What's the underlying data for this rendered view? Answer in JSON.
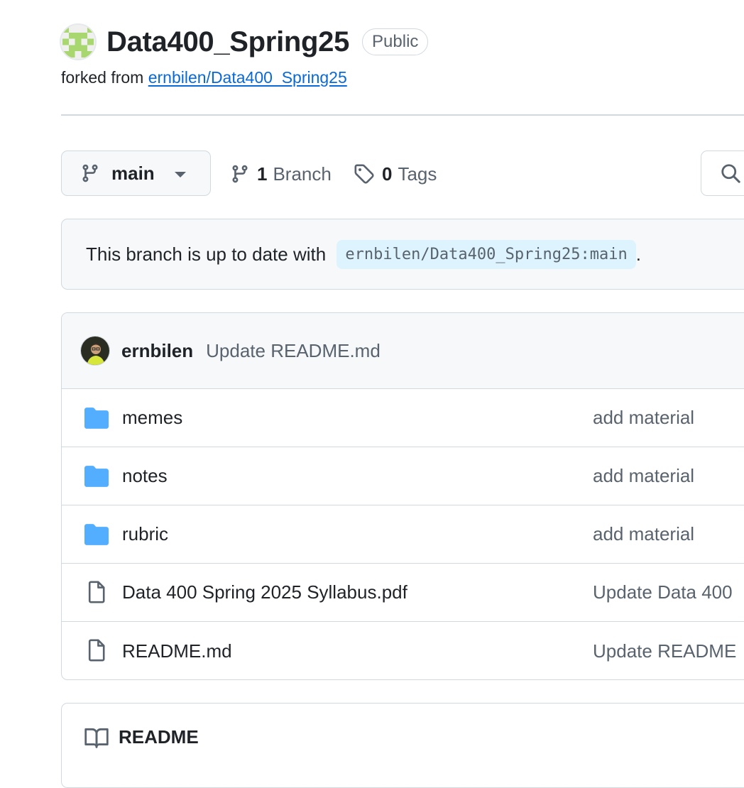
{
  "repo": {
    "name": "Data400_Spring25",
    "visibility": "Public",
    "fork_prefix": "forked from ",
    "fork_source": "ernbilen/Data400_Spring25"
  },
  "toolbar": {
    "branch_selector": "main",
    "branches_count": "1",
    "branches_label": "Branch",
    "tags_count": "0",
    "tags_label": "Tags"
  },
  "banner": {
    "text_before": "This branch is up to date with ",
    "ref": "ernbilen/Data400_Spring25:main",
    "text_after": "."
  },
  "latest_commit": {
    "author": "ernbilen",
    "message": "Update README.md"
  },
  "files": [
    {
      "name": "memes",
      "type": "folder",
      "commit": "add material"
    },
    {
      "name": "notes",
      "type": "folder",
      "commit": "add material"
    },
    {
      "name": "rubric",
      "type": "folder",
      "commit": "add material"
    },
    {
      "name": "Data 400 Spring 2025 Syllabus.pdf",
      "type": "file",
      "commit": "Update Data 400"
    },
    {
      "name": "README.md",
      "type": "file",
      "commit": "Update README"
    }
  ],
  "readme": {
    "title": "README"
  },
  "colors": {
    "link": "#0969da",
    "folder": "#54aeff",
    "muted": "#59636e",
    "border": "#d1d9e0"
  }
}
